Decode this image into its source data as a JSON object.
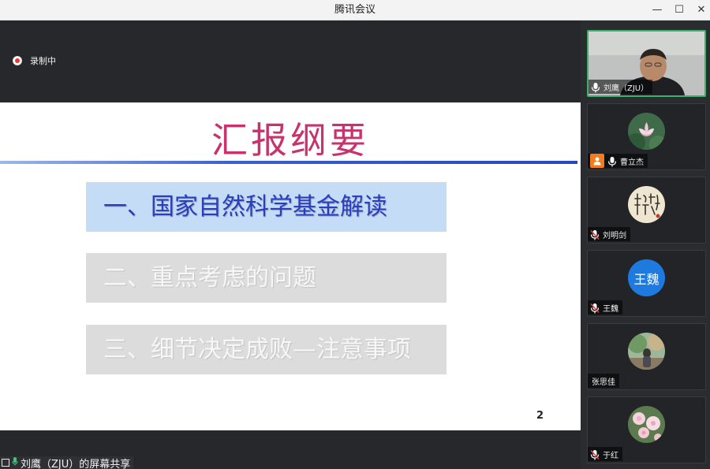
{
  "window": {
    "title": "腾讯会议",
    "minimize_glyph": "—",
    "maximize_glyph": "☐",
    "close_glyph": "✕"
  },
  "recording": {
    "label": "录制中",
    "color": "#e53935"
  },
  "slide": {
    "title": "汇报纲要",
    "items": [
      {
        "label": "一、国家自然科学基金解读"
      },
      {
        "label": "二、重点考虑的问题"
      },
      {
        "label": "三、细节决定成败—注意事项"
      }
    ],
    "page_number": "2",
    "title_color": "#c8336e",
    "active_color": "#2a3dbd"
  },
  "share": {
    "label": "刘鹰（ZJU）的屏幕共享"
  },
  "participants": [
    {
      "name": "刘鹰（ZJU）",
      "mic": "on",
      "video": true,
      "speaking": true
    },
    {
      "name": "曹立杰",
      "mic": "on",
      "host": true,
      "avatar": "lotus-flower"
    },
    {
      "name": "刘明剑",
      "mic": "muted",
      "avatar": "calligraphy"
    },
    {
      "name": "王魏",
      "mic": "muted",
      "avatar_text": "王魏",
      "avatar_color": "#1f7ae0"
    },
    {
      "name": "张思佳",
      "mic": "none",
      "avatar": "outdoor-photo"
    },
    {
      "name": "于红",
      "mic": "muted",
      "avatar": "flowers"
    }
  ],
  "accent": "#3ab26c"
}
